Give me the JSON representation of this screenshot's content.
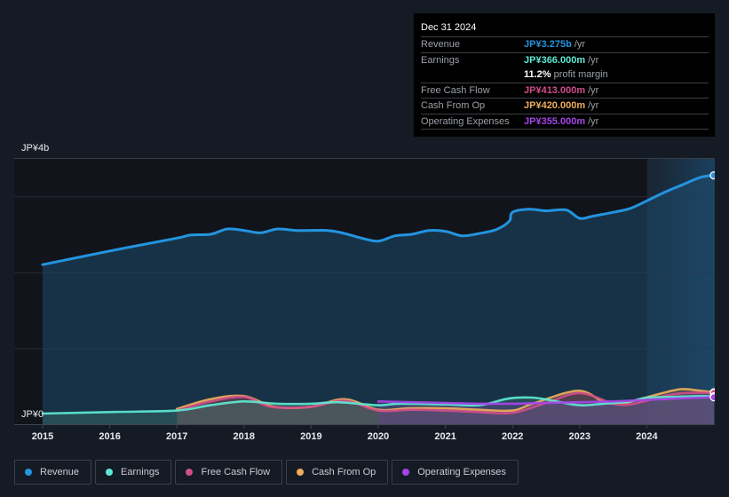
{
  "tooltip": {
    "date": "Dec 31 2024",
    "rows": [
      {
        "label": "Revenue",
        "value": "JP¥3.275b",
        "unit": "/yr",
        "color": "#2394df"
      },
      {
        "label": "Earnings",
        "value": "JP¥366.000m",
        "unit": "/yr",
        "color": "#5ee8d3"
      },
      {
        "label": "",
        "value": "11.2%",
        "unit": "profit margin",
        "color": "#ffffff"
      },
      {
        "label": "Free Cash Flow",
        "value": "JP¥413.000m",
        "unit": "/yr",
        "color": "#d14d8b"
      },
      {
        "label": "Cash From Op",
        "value": "JP¥420.000m",
        "unit": "/yr",
        "color": "#eeac5c"
      },
      {
        "label": "Operating Expenses",
        "value": "JP¥355.000m",
        "unit": "/yr",
        "color": "#a545e8"
      }
    ]
  },
  "legend": [
    {
      "label": "Revenue",
      "color": "#2394df"
    },
    {
      "label": "Earnings",
      "color": "#5ee8d3"
    },
    {
      "label": "Free Cash Flow",
      "color": "#d14d8b"
    },
    {
      "label": "Cash From Op",
      "color": "#eeac5c"
    },
    {
      "label": "Operating Expenses",
      "color": "#a545e8"
    }
  ],
  "chart_data": {
    "type": "area",
    "title": "",
    "xlabel": "",
    "ylabel": "",
    "y_unit": "JP¥ billions",
    "y_labels": {
      "top": "JP¥4b",
      "bottom": "JP¥0"
    },
    "ylim": [
      0,
      3.5
    ],
    "xlim": [
      2015,
      2025
    ],
    "x_ticks": [
      "2015",
      "2016",
      "2017",
      "2018",
      "2019",
      "2020",
      "2021",
      "2022",
      "2023",
      "2024"
    ],
    "gridlines": [
      1,
      2,
      3
    ],
    "highlight_range": [
      2024,
      2025
    ],
    "series": [
      {
        "name": "Revenue",
        "color": "#2394df",
        "x": [
          2015.0,
          2016.0,
          2017.0,
          2017.2,
          2017.5,
          2017.75,
          2018.0,
          2018.25,
          2018.5,
          2018.8,
          2019.25,
          2019.5,
          2019.75,
          2020.0,
          2020.25,
          2020.5,
          2020.75,
          2021.0,
          2021.25,
          2021.5,
          2021.75,
          2021.95,
          2022.0,
          2022.25,
          2022.5,
          2022.8,
          2023.0,
          2023.2,
          2023.5,
          2023.75,
          2024.0,
          2024.28,
          2024.5,
          2024.8,
          2025.0
        ],
        "values": [
          2.1,
          2.28,
          2.45,
          2.49,
          2.5,
          2.57,
          2.55,
          2.52,
          2.57,
          2.55,
          2.55,
          2.51,
          2.45,
          2.41,
          2.48,
          2.5,
          2.55,
          2.54,
          2.48,
          2.51,
          2.56,
          2.67,
          2.79,
          2.83,
          2.81,
          2.82,
          2.71,
          2.74,
          2.79,
          2.84,
          2.94,
          3.06,
          3.14,
          3.25,
          3.275
        ]
      },
      {
        "name": "Earnings",
        "color": "#5ee8d3",
        "x": [
          2015.0,
          2016.0,
          2017.0,
          2017.5,
          2018.0,
          2018.5,
          2019.0,
          2019.4,
          2020.0,
          2020.3,
          2021.0,
          2021.5,
          2021.95,
          2022.3,
          2022.6,
          2023.0,
          2023.35,
          2023.75,
          2024.0,
          2024.4,
          2024.8,
          2025.0
        ],
        "values": [
          0.14,
          0.16,
          0.18,
          0.25,
          0.3,
          0.27,
          0.27,
          0.29,
          0.25,
          0.27,
          0.26,
          0.25,
          0.34,
          0.35,
          0.31,
          0.25,
          0.27,
          0.3,
          0.35,
          0.36,
          0.37,
          0.366
        ]
      },
      {
        "name": "Free Cash Flow",
        "color": "#d14d8b",
        "x": [
          2017.0,
          2017.5,
          2018.0,
          2018.4,
          2019.0,
          2019.5,
          2020.0,
          2020.5,
          2021.0,
          2021.5,
          2022.0,
          2022.5,
          2023.0,
          2023.5,
          2023.75,
          2024.0,
          2024.3,
          2024.55,
          2025.0
        ],
        "values": [
          0.18,
          0.3,
          0.36,
          0.23,
          0.23,
          0.31,
          0.18,
          0.19,
          0.18,
          0.16,
          0.15,
          0.28,
          0.41,
          0.27,
          0.26,
          0.31,
          0.38,
          0.41,
          0.413
        ]
      },
      {
        "name": "Cash From Op",
        "color": "#eeac5c",
        "x": [
          2017.0,
          2017.5,
          2018.0,
          2018.45,
          2019.0,
          2019.5,
          2020.0,
          2020.45,
          2021.0,
          2021.5,
          2022.0,
          2022.3,
          2022.97,
          2023.35,
          2023.6,
          2023.9,
          2024.15,
          2024.5,
          2024.8,
          2025.0
        ],
        "values": [
          0.2,
          0.33,
          0.37,
          0.23,
          0.23,
          0.33,
          0.19,
          0.21,
          0.21,
          0.19,
          0.18,
          0.27,
          0.44,
          0.3,
          0.27,
          0.33,
          0.39,
          0.46,
          0.44,
          0.42
        ]
      },
      {
        "name": "Operating Expenses",
        "color": "#a545e8",
        "x": [
          2020.0,
          2020.5,
          2021.0,
          2021.5,
          2022.0,
          2022.5,
          2023.0,
          2023.5,
          2024.0,
          2024.5,
          2025.0
        ],
        "values": [
          0.3,
          0.29,
          0.28,
          0.27,
          0.27,
          0.28,
          0.29,
          0.3,
          0.32,
          0.34,
          0.355
        ]
      }
    ]
  }
}
